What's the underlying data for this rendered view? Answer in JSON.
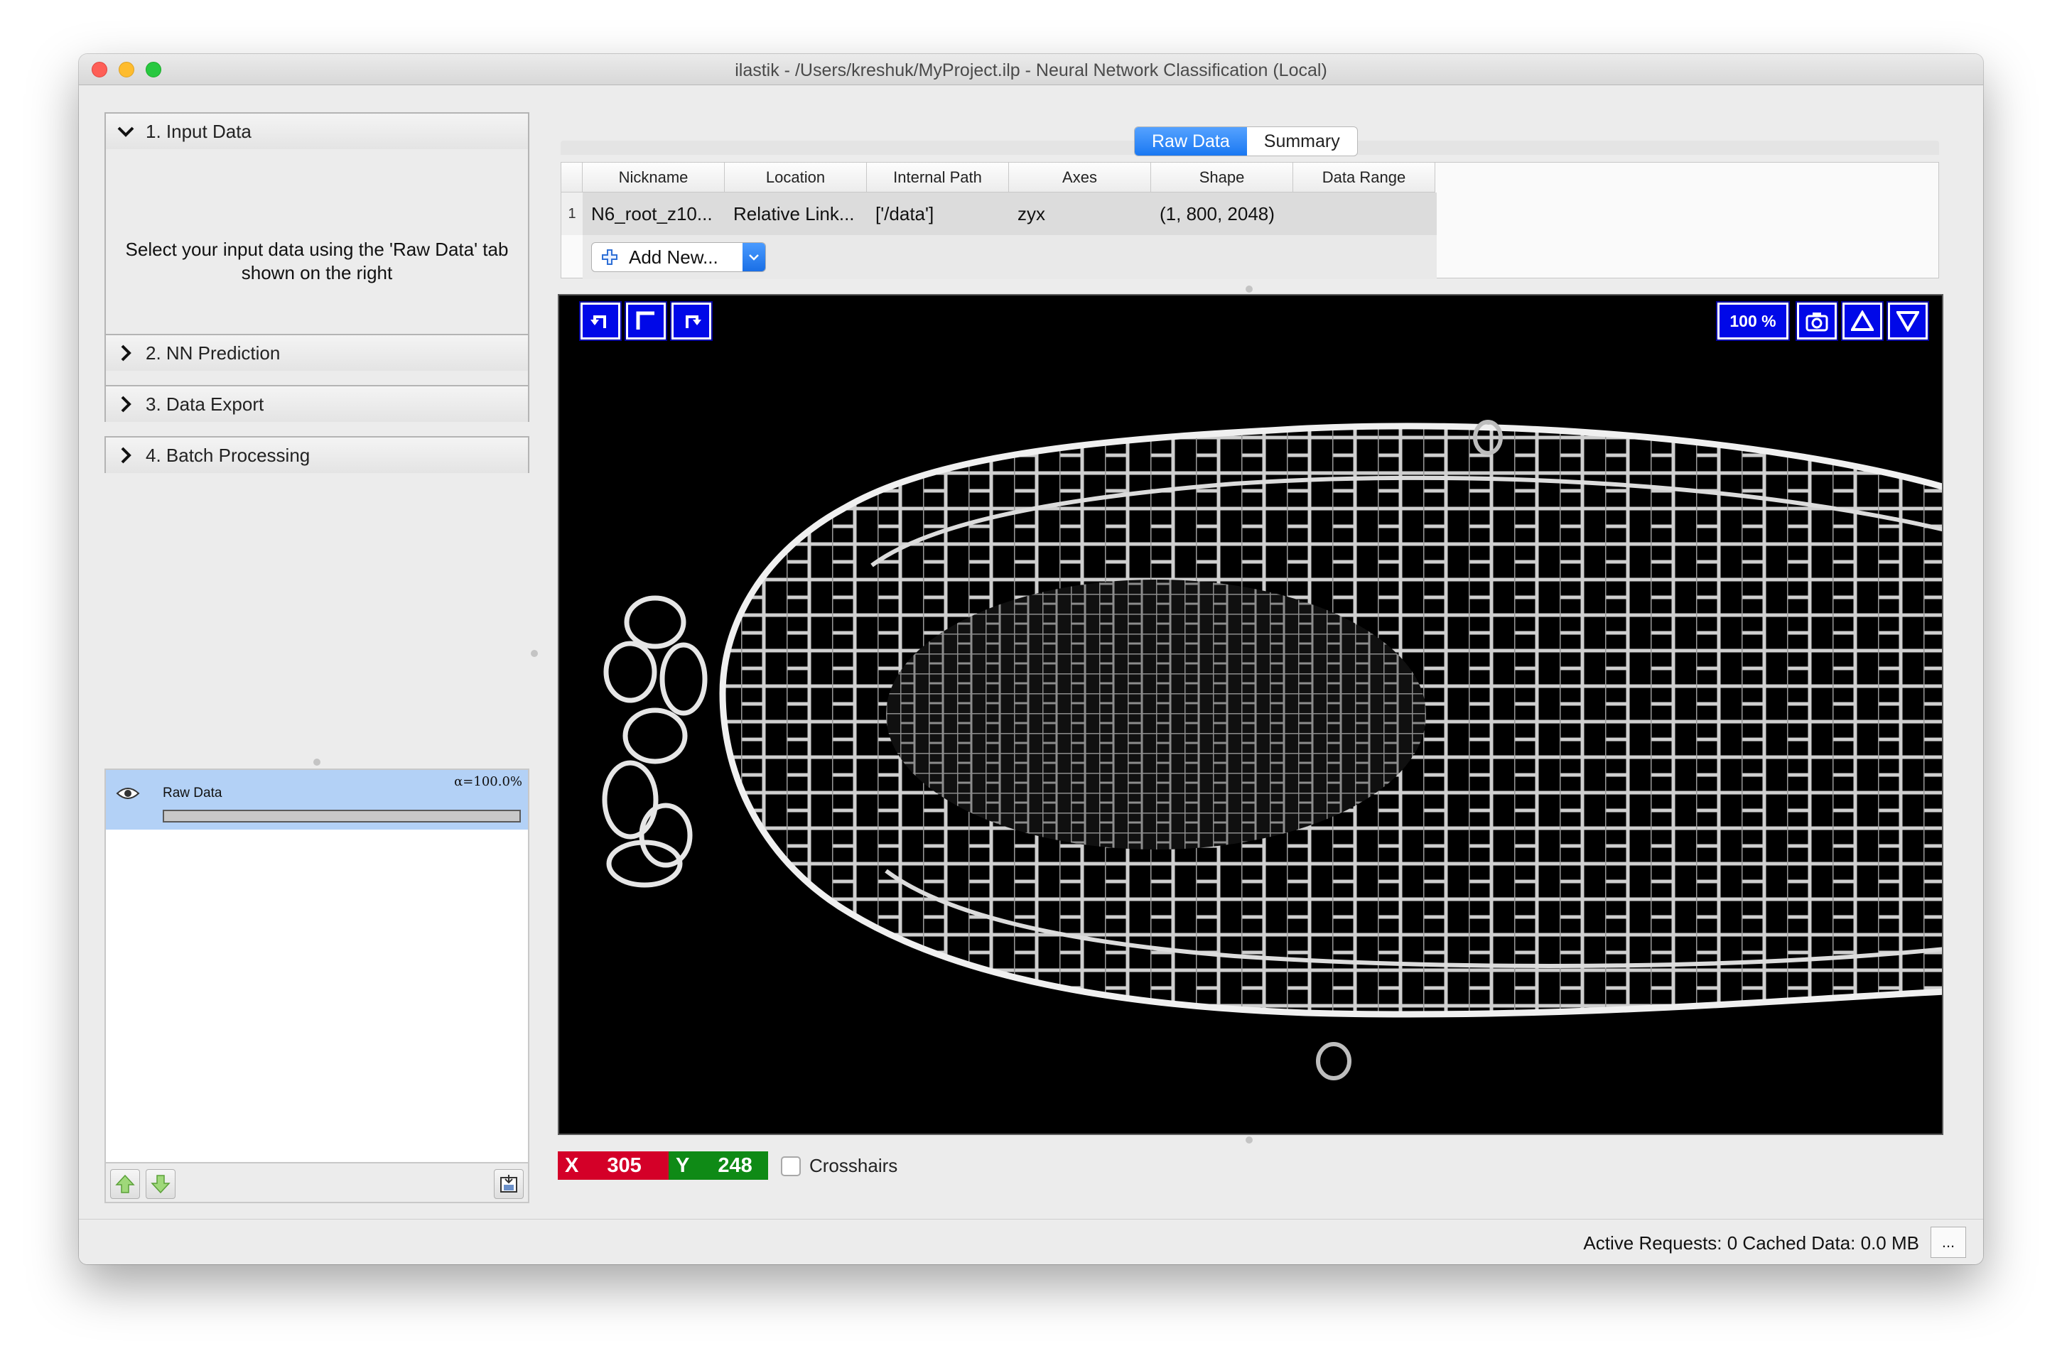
{
  "window": {
    "title": "ilastik - /Users/kreshuk/MyProject.ilp - Neural Network Classification (Local)"
  },
  "applets": [
    {
      "label": "1. Input Data",
      "expanded": true
    },
    {
      "label": "2. NN Prediction",
      "expanded": false
    },
    {
      "label": "3. Data Export",
      "expanded": false
    },
    {
      "label": "4. Batch Processing",
      "expanded": false
    }
  ],
  "input_data_help": "Select your input data using the 'Raw Data' tab shown on the right",
  "layers": [
    {
      "name": "Raw Data",
      "opacity": "α=100.0%",
      "visible": true
    }
  ],
  "data_tabs": [
    {
      "label": "Raw Data",
      "active": true
    },
    {
      "label": "Summary",
      "active": false
    }
  ],
  "dataset_table": {
    "columns": [
      "Nickname",
      "Location",
      "Internal Path",
      "Axes",
      "Shape",
      "Data Range"
    ],
    "rows": [
      {
        "index": "1",
        "nickname": "N6_root_z10...",
        "location": "Relative Link...",
        "internal_path": "['/data']",
        "axes": "zyx",
        "shape": "(1, 800, 2048)",
        "data_range": ""
      }
    ],
    "add_button": "Add New..."
  },
  "viewer": {
    "zoom": "100 %",
    "tool_icons": [
      "undo-rotate-icon",
      "reset-view-icon",
      "redo-rotate-icon",
      "camera-icon",
      "slice-up-icon",
      "slice-down-icon"
    ]
  },
  "coords": {
    "x_label": "X",
    "x_value": "305",
    "y_label": "Y",
    "y_value": "248"
  },
  "crosshairs_label": "Crosshairs",
  "status": {
    "text": "Active Requests: 0  Cached Data: 0.0 MB",
    "button": "..."
  },
  "colors": {
    "accent": "#1a78f2",
    "viewer_button": "#0008e8",
    "x_coord": "#d40028",
    "y_coord": "#0f8a16",
    "layer_selected": "#b3d1f6"
  }
}
